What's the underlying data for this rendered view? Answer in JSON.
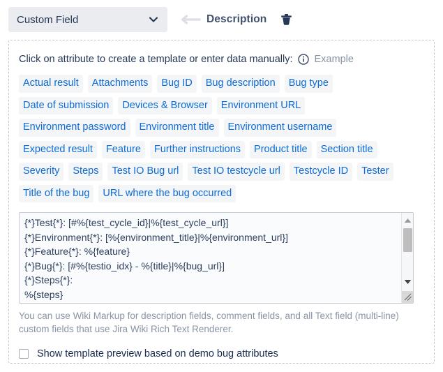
{
  "header": {
    "field_select": {
      "value": "Custom Field",
      "chevron_icon": "chevron-down-icon"
    },
    "back_arrow_icon": "arrow-left-icon",
    "title": "Description",
    "delete_icon": "trash-icon"
  },
  "panel": {
    "hint": "Click on attribute to create a template or enter data manually:",
    "info_icon": "info-circle-icon",
    "example_link": "Example",
    "attributes": [
      "Actual result",
      "Attachments",
      "Bug ID",
      "Bug description",
      "Bug type",
      "Date of submission",
      "Devices & Browser",
      "Environment URL",
      "Environment password",
      "Environment title",
      "Environment username",
      "Expected result",
      "Feature",
      "Further instructions",
      "Product title",
      "Section title",
      "Severity",
      "Steps",
      "Test IO Bug url",
      "Test IO testcycle url",
      "Testcycle ID",
      "Tester",
      "Title of the bug",
      "URL where the bug occurred"
    ],
    "template_editor": {
      "value": "{*}Test{*}: [#%{test_cycle_id}|%{test_cycle_url}]\n{*}Environment{*}: [%{environment_title}|%{environment_url}]\n{*}Feature{*}: %{feature}\n{*}Bug{*}: [#%{testio_idx} - %{title}|%{bug_url}]\n{*}Steps{*}:\n%{steps}",
      "placeholder": "",
      "scrollbar_up_icon": "triangle-up-icon",
      "scrollbar_down_icon": "triangle-down-icon",
      "resize_grip_icon": "resize-handle-icon"
    },
    "help_text": "You can use Wiki Markup for description fields, comment fields, and all Text field (multi-line) custom fields that use Jira Wiki Rich Text Renderer.",
    "preview_checkbox": {
      "label": "Show template preview based on demo bug attributes",
      "checked": false
    }
  },
  "colors": {
    "tag_text": "#0b6bd8",
    "tag_bg": "#f4f5f7",
    "select_bg": "#ebecf0",
    "title_text": "#42526e",
    "muted_text": "#8993a4",
    "panel_border": "#c1c7d0"
  }
}
